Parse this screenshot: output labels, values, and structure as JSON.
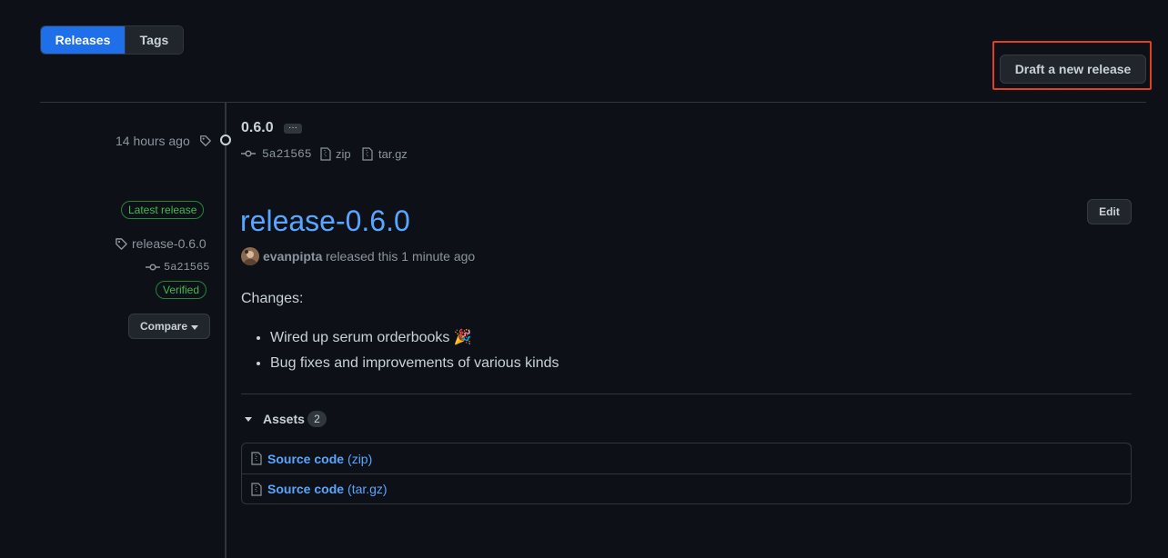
{
  "tabs": [
    {
      "label": "Releases",
      "active": true
    },
    {
      "label": "Tags",
      "active": false
    }
  ],
  "draft_button_label": "Draft a new release",
  "tag_entry": {
    "time": "14 hours ago",
    "version": "0.6.0",
    "more_label": "···",
    "commit": "5a21565",
    "zip_label": "zip",
    "targz_label": "tar.gz"
  },
  "release": {
    "latest_badge": "Latest release",
    "tag_name": "release-0.6.0",
    "commit": "5a21565",
    "verified_badge": "Verified",
    "compare_label": "Compare",
    "title": "release-0.6.0",
    "edit_label": "Edit",
    "author": "evanpipta",
    "released_text": "released this 1 minute ago",
    "body_heading": "Changes:",
    "changes": [
      "Wired up serum orderbooks 🎉",
      "Bug fixes and improvements of various kinds"
    ]
  },
  "assets": {
    "label": "Assets",
    "count": "2",
    "items": [
      {
        "name": "Source code",
        "ext": "(zip)"
      },
      {
        "name": "Source code",
        "ext": "(tar.gz)"
      }
    ]
  },
  "colors": {
    "background": "#0d1117",
    "accent": "#1f6feb",
    "link": "#58a6ff",
    "success": "#3fb950",
    "highlight": "#e2401c"
  }
}
